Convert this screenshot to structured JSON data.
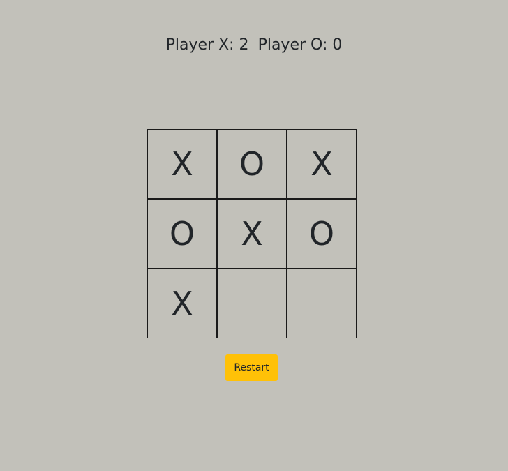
{
  "scoreboard": {
    "player_x": "Player X: 2",
    "player_o": "Player O: 0"
  },
  "board": {
    "cells": [
      "X",
      "O",
      "X",
      "O",
      "X",
      "O",
      "X",
      "",
      ""
    ]
  },
  "controls": {
    "restart_label": "Restart"
  },
  "colors": {
    "background": "#c2c1ba",
    "restart_button": "#ffc107",
    "text": "#212529"
  }
}
